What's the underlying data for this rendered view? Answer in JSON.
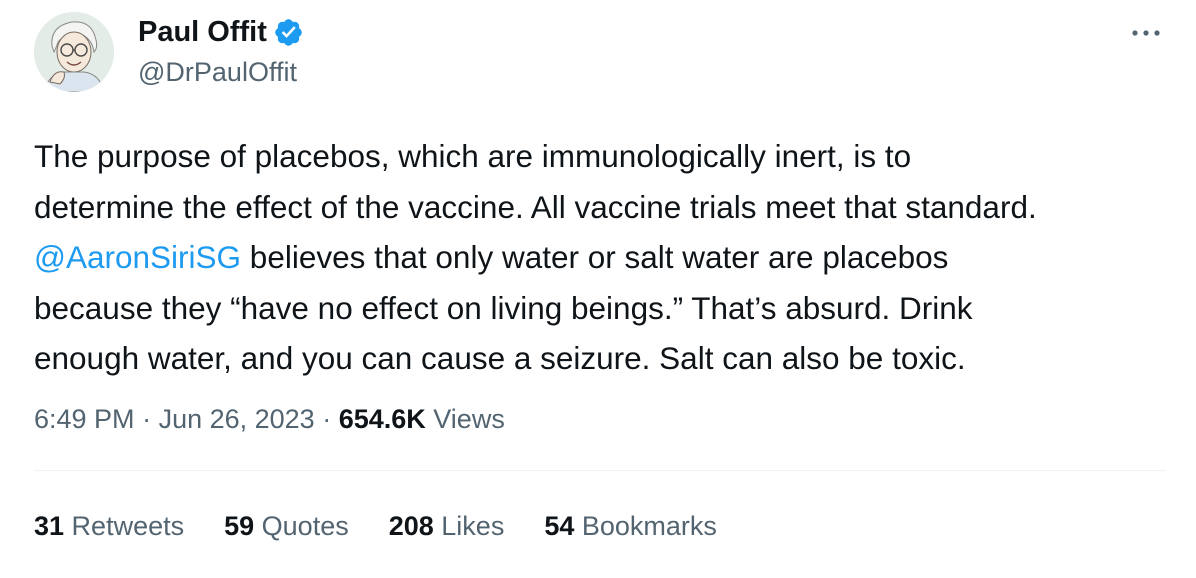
{
  "author": {
    "name": "Paul Offit",
    "handle": "@DrPaulOffit",
    "verified": true,
    "avatar_icon": "cartoon-portrait-avatar"
  },
  "tweet": {
    "lines": [
      [
        {
          "text": "The purpose of placebos, which are immunologically inert, is to"
        }
      ],
      [
        {
          "text": "determine the effect of the vaccine. All vaccine trials meet that standard."
        }
      ],
      [
        {
          "text": "@AaronSiriSG",
          "mention": true
        },
        {
          "text": " believes that only water or salt water are placebos"
        }
      ],
      [
        {
          "text": "because they “have no effect on living beings.” That’s absurd. Drink"
        }
      ],
      [
        {
          "text": "enough water, and you can cause a seizure. Salt can also be toxic."
        }
      ]
    ]
  },
  "meta": {
    "time": "6:49 PM",
    "sep1": " · ",
    "date": "Jun 26, 2023",
    "sep2": " · ",
    "views_count": "654.6K",
    "views_label": " Views"
  },
  "stats": [
    {
      "count": "31",
      "label": " Retweets",
      "name": "retweets-stat"
    },
    {
      "count": "59",
      "label": " Quotes",
      "name": "quotes-stat"
    },
    {
      "count": "208",
      "label": " Likes",
      "name": "likes-stat"
    },
    {
      "count": "54",
      "label": " Bookmarks",
      "name": "bookmarks-stat"
    }
  ],
  "colors": {
    "text": "#0f1419",
    "secondary": "#536471",
    "accent": "#1d9bf0",
    "divider": "#eff3f4"
  },
  "icons": {
    "verified": "verified-badge-icon",
    "more": "more-options-icon"
  }
}
